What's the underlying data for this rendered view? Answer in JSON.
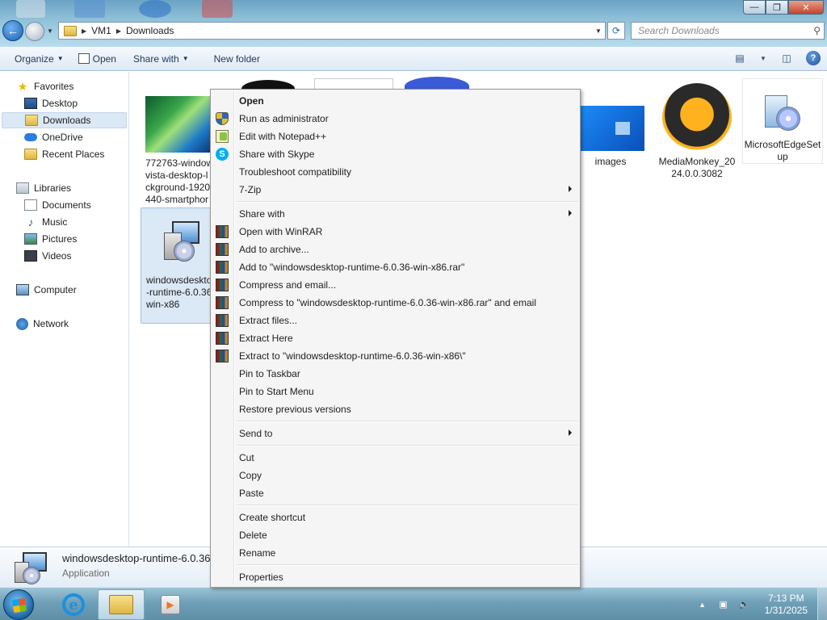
{
  "window": {
    "buttons": {
      "minimize": "—",
      "maximize": "❐",
      "close": "✕"
    }
  },
  "address": {
    "crumbs": [
      "VM1",
      "Downloads"
    ],
    "search_placeholder": "Search Downloads"
  },
  "toolbar": {
    "organize": "Organize",
    "open": "Open",
    "share_with": "Share with",
    "new_folder": "New folder"
  },
  "sidebar": {
    "favorites": "Favorites",
    "desktop": "Desktop",
    "downloads": "Downloads",
    "onedrive": "OneDrive",
    "recent_places": "Recent Places",
    "libraries": "Libraries",
    "documents": "Documents",
    "music": "Music",
    "pictures": "Pictures",
    "videos": "Videos",
    "computer": "Computer",
    "network": "Network"
  },
  "files": [
    {
      "name": "772763-windows-vista-desktop-background-1920x1440-smartphone",
      "display": "772763-window\nvista-desktop-l\nckground-1920\n440-smartphor"
    },
    {
      "name": "images",
      "display": "images"
    },
    {
      "name": "MediaMonkey_2024.0.0.3082",
      "display": "MediaMonkey_20\n24.0.0.3082"
    },
    {
      "name": "MicrosoftEdgeSetup",
      "display": "MicrosoftEdgeSet\nup"
    },
    {
      "name": "windowsdesktop-runtime-6.0.36-win-x86",
      "display": "windowsdeskto\n-runtime-6.0.36\nwin-x86"
    }
  ],
  "details": {
    "name": "windowsdesktop-runtime-6.0.36",
    "type": "Application"
  },
  "context_menu": {
    "open": "Open",
    "run_as_admin": "Run as administrator",
    "edit_notepadpp": "Edit with Notepad++",
    "share_skype": "Share with Skype",
    "troubleshoot": "Troubleshoot compatibility",
    "zip7": "7-Zip",
    "share_with": "Share with",
    "open_winrar": "Open with WinRAR",
    "add_archive": "Add to archive...",
    "add_to_rar": "Add to \"windowsdesktop-runtime-6.0.36-win-x86.rar\"",
    "compress_email": "Compress and email...",
    "compress_to_rar_email": "Compress to \"windowsdesktop-runtime-6.0.36-win-x86.rar\" and email",
    "extract_files": "Extract files...",
    "extract_here": "Extract Here",
    "extract_to": "Extract to \"windowsdesktop-runtime-6.0.36-win-x86\\\"",
    "pin_taskbar": "Pin to Taskbar",
    "pin_start": "Pin to Start Menu",
    "restore_versions": "Restore previous versions",
    "send_to": "Send to",
    "cut": "Cut",
    "copy": "Copy",
    "paste": "Paste",
    "create_shortcut": "Create shortcut",
    "delete": "Delete",
    "rename": "Rename",
    "properties": "Properties"
  },
  "taskbar": {
    "time": "7:13 PM",
    "date": "1/31/2025"
  }
}
